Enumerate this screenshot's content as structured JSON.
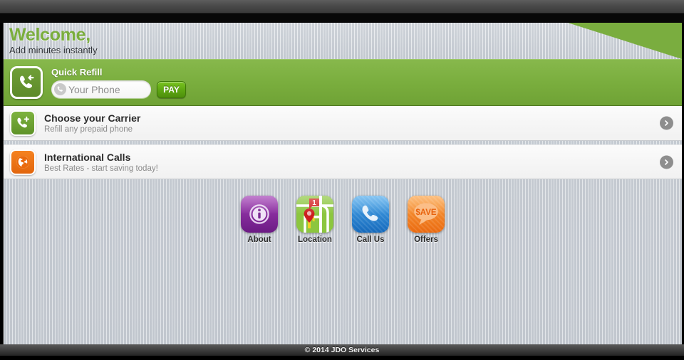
{
  "header": {
    "welcome_title": "Welcome,",
    "subtitle": "Add minutes instantly",
    "accent_color": "#7aad3c"
  },
  "quick_refill": {
    "title": "Quick Refill",
    "icon": "phone-incoming-icon",
    "input_placeholder": "Your Phone",
    "input_value": "",
    "input_icon": "phone-icon",
    "pay_label": "PAY",
    "panel_color": "#7aae3e"
  },
  "menu_rows": [
    {
      "title": "Choose your Carrier",
      "subtitle": "Refill any prepaid phone",
      "icon": "phone-plus-icon",
      "icon_color": "#7db33f",
      "chevron": "chevron-right-icon"
    },
    {
      "title": "International Calls",
      "subtitle": "Best Rates - start saving today!",
      "icon": "globe-icon",
      "icon_color": "#f58220",
      "chevron": "chevron-right-icon"
    }
  ],
  "app_icons": [
    {
      "label": "About",
      "icon": "info-circle-icon",
      "color": "#8a2fa3"
    },
    {
      "label": "Location",
      "icon": "map-pin-icon",
      "color": "#7cc02e"
    },
    {
      "label": "Call Us",
      "icon": "phone-handset-icon",
      "color": "#1f7fd0"
    },
    {
      "label": "Offers",
      "icon": "save-bubble-icon",
      "color": "#f4811f",
      "bubble_text": "$AVE"
    }
  ],
  "footer": {
    "copyright": "© 2014 JDO Services"
  }
}
